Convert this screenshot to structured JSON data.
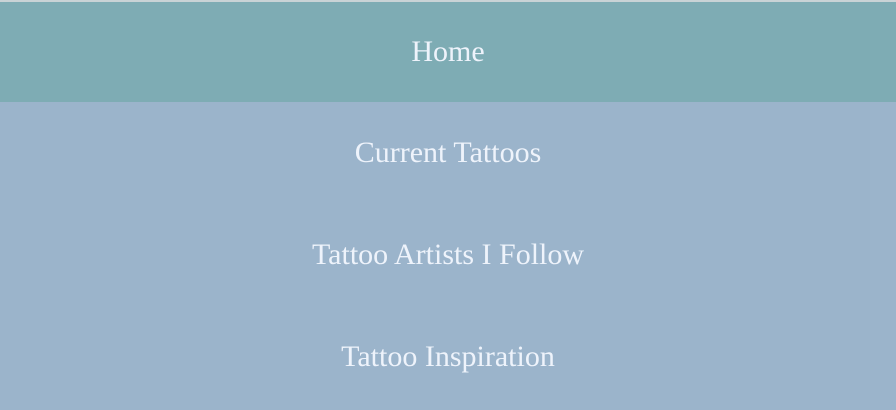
{
  "nav": {
    "items": [
      {
        "label": "Home",
        "active": true
      },
      {
        "label": "Current Tattoos",
        "active": false
      },
      {
        "label": "Tattoo Artists I Follow",
        "active": false
      },
      {
        "label": "Tattoo Inspiration",
        "active": false
      }
    ]
  },
  "colors": {
    "background": "#9bb4cb",
    "active_background": "#7eacb4",
    "text": "#eef3fb"
  }
}
